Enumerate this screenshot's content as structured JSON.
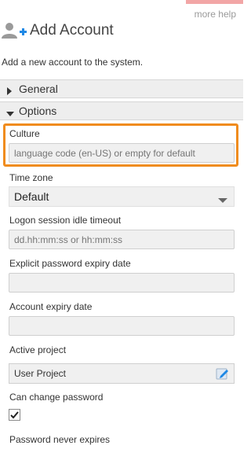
{
  "help": {
    "label": "more help"
  },
  "header": {
    "title": "Add Account",
    "subtitle": "Add a new account to the system."
  },
  "sections": {
    "general": "General",
    "options": "Options"
  },
  "fields": {
    "culture": {
      "label": "Culture",
      "placeholder": "language code (en-US) or empty for default"
    },
    "time_zone": {
      "label": "Time zone",
      "value": "Default"
    },
    "idle_timeout": {
      "label": "Logon session idle timeout",
      "placeholder": "dd.hh:mm:ss or hh:mm:ss"
    },
    "password_expiry": {
      "label": "Explicit password expiry date",
      "value": ""
    },
    "account_expiry": {
      "label": "Account expiry date",
      "value": ""
    },
    "active_project": {
      "label": "Active project",
      "value": "User Project"
    },
    "can_change_password": {
      "label": "Can change password",
      "checked": true
    },
    "password_never_expires": {
      "label": "Password never expires"
    }
  },
  "colors": {
    "highlight": "#f08c1e",
    "accent_blue": "#1e88e5",
    "help_bar": "#f2a6a6"
  },
  "icons": {
    "title": "add-user-icon",
    "edit": "edit-pencil-icon"
  }
}
